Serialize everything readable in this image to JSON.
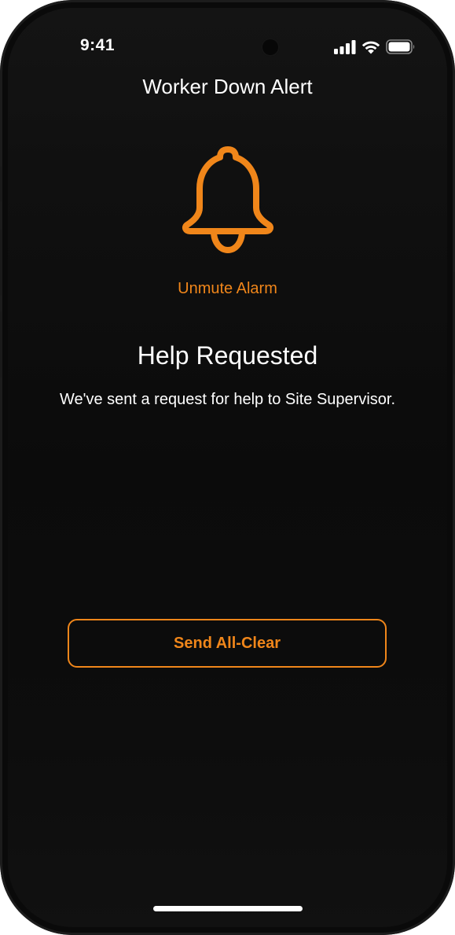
{
  "status_bar": {
    "time": "9:41",
    "signal_icon": "cellular-signal-icon",
    "wifi_icon": "wifi-icon",
    "battery_icon": "battery-icon"
  },
  "header": {
    "title": "Worker Down Alert"
  },
  "alarm": {
    "icon": "bell-icon",
    "unmute_label": "Unmute Alarm"
  },
  "message": {
    "title": "Help Requested",
    "body": "We've sent a request for help to Site Supervisor."
  },
  "actions": {
    "all_clear_label": "Send All-Clear"
  },
  "colors": {
    "accent": "#f0861a",
    "background": "#0d0d0d",
    "text": "#ffffff"
  }
}
